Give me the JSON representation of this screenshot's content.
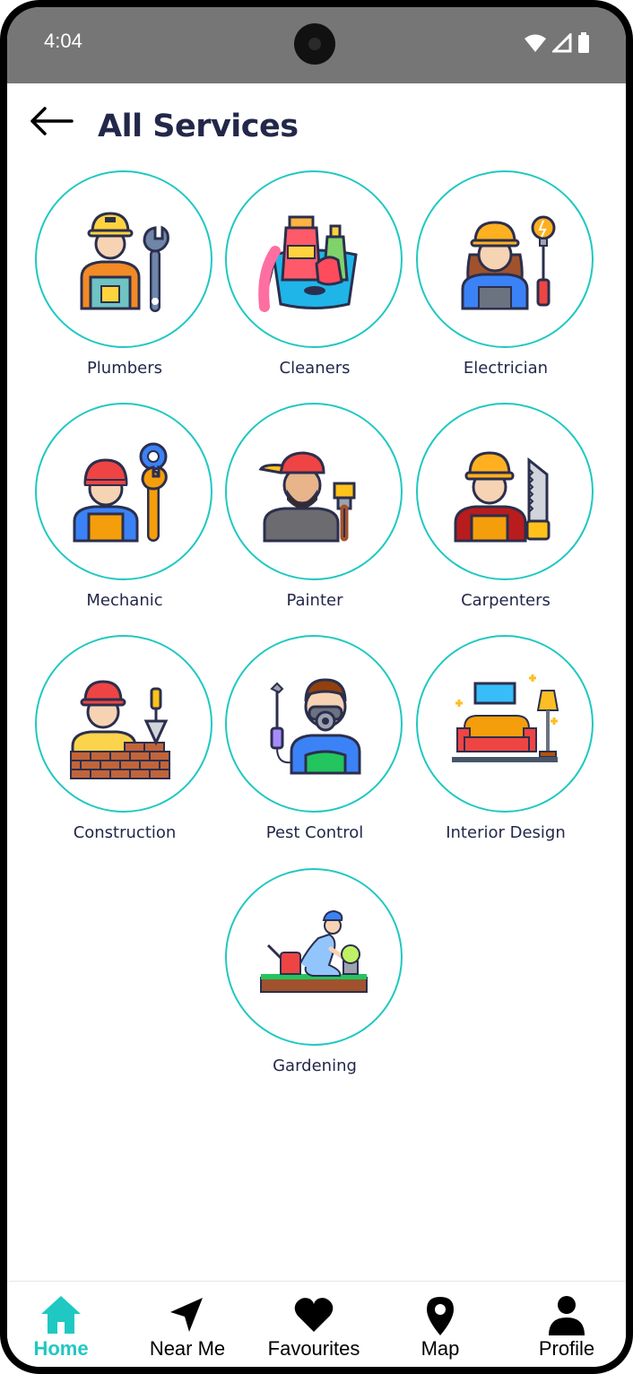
{
  "status_bar": {
    "time": "4:04"
  },
  "header": {
    "title": "All Services"
  },
  "services": [
    {
      "label": "Plumbers",
      "icon": "plumber-icon"
    },
    {
      "label": "Cleaners",
      "icon": "cleaning-supplies-icon"
    },
    {
      "label": "Electrician",
      "icon": "electrician-icon"
    },
    {
      "label": "Mechanic",
      "icon": "mechanic-icon"
    },
    {
      "label": "Painter",
      "icon": "painter-icon"
    },
    {
      "label": "Carpenters",
      "icon": "carpenter-icon"
    },
    {
      "label": "Construction",
      "icon": "construction-worker-icon"
    },
    {
      "label": "Pest Control",
      "icon": "pest-control-icon"
    },
    {
      "label": "Interior Design",
      "icon": "interior-design-icon"
    },
    {
      "label": "Gardening",
      "icon": "gardening-icon"
    }
  ],
  "bottom_nav": {
    "items": [
      {
        "label": "Home",
        "icon": "home-icon",
        "active": true
      },
      {
        "label": "Near Me",
        "icon": "navigation-arrow-icon",
        "active": false
      },
      {
        "label": "Favourites",
        "icon": "heart-icon",
        "active": false
      },
      {
        "label": "Map",
        "icon": "map-pin-icon",
        "active": false
      },
      {
        "label": "Profile",
        "icon": "person-icon",
        "active": false
      }
    ]
  },
  "colors": {
    "accent": "#1fc8c2",
    "title": "#23284a",
    "status_bar": "#767676"
  }
}
